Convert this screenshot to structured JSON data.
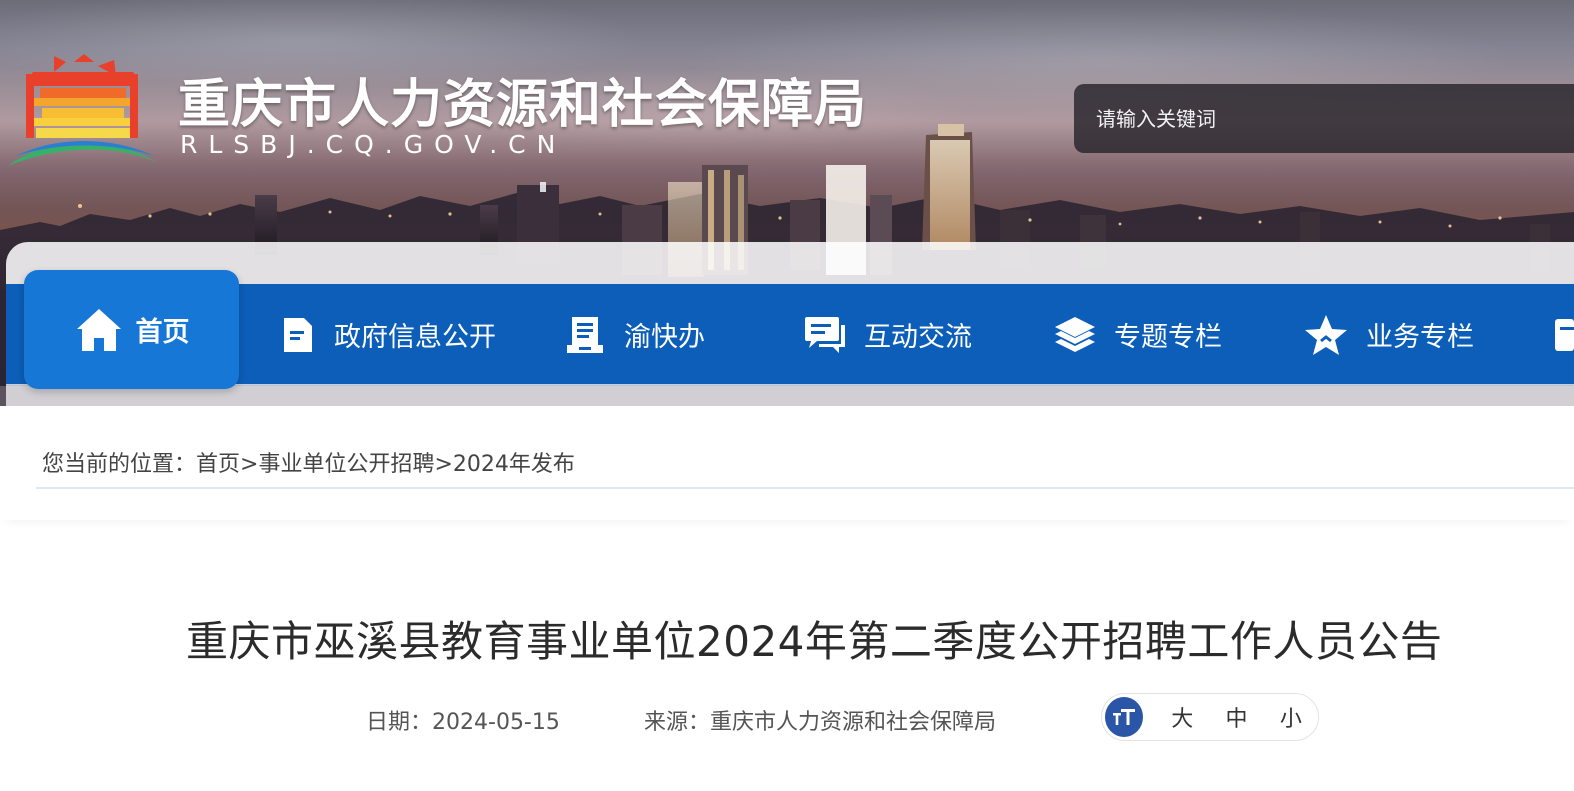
{
  "header": {
    "site_title": "重庆市人力资源和社会保障局",
    "site_url": "RLSBJ.CQ.GOV.CN",
    "logo_icon": "temple-of-heaven-logo-icon"
  },
  "search": {
    "placeholder": "请输入关键词"
  },
  "nav": {
    "items": [
      {
        "label": "首页",
        "icon": "home-icon"
      },
      {
        "label": "政府信息公开",
        "icon": "document-icon"
      },
      {
        "label": "渝快办",
        "icon": "list-document-icon"
      },
      {
        "label": "互动交流",
        "icon": "chat-icon"
      },
      {
        "label": "专题专栏",
        "icon": "layers-icon"
      },
      {
        "label": "业务专栏",
        "icon": "star-icon"
      }
    ],
    "active_index": 0,
    "colors": {
      "bar": "#0c5eb8",
      "active": "#1677d6"
    }
  },
  "breadcrumb": {
    "prefix": "您当前的位置：",
    "items": [
      "首页",
      "事业单位公开招聘",
      "2024年发布"
    ],
    "separator": ">"
  },
  "article": {
    "title": "重庆市巫溪县教育事业单位2024年第二季度公开招聘工作人员公告",
    "date_label": "日期：",
    "date": "2024-05-15",
    "source_label": "来源：",
    "source": "重庆市人力资源和社会保障局"
  },
  "font_size_control": {
    "icon": "text-size-icon",
    "options": [
      "大",
      "中",
      "小"
    ]
  }
}
